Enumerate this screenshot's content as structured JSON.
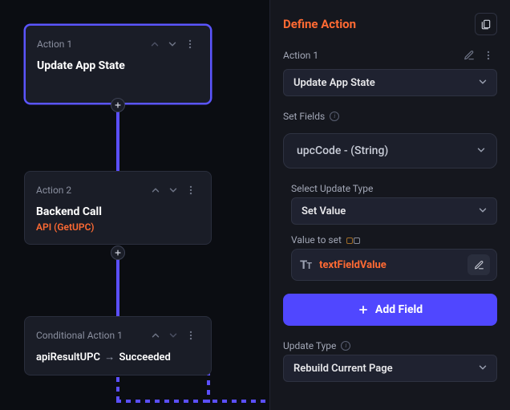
{
  "canvas": {
    "node1": {
      "label": "Action 1",
      "title": "Update App State"
    },
    "node2": {
      "label": "Action 2",
      "title": "Backend Call",
      "sub": "API (GetUPC)"
    },
    "node3": {
      "label": "Conditional Action 1",
      "cond_left": "apiResultUPC",
      "cond_arrow": "→",
      "cond_right": "Succeeded"
    }
  },
  "panel": {
    "title": "Define Action",
    "action_label": "Action 1",
    "action_select": "Update App State",
    "setfields_label": "Set Fields",
    "field_select": "upcCode - (String)",
    "update_type_label": "Select Update Type",
    "update_type_select": "Set Value",
    "value_label": "Value to set",
    "value_text": "textFieldValue",
    "add_field_btn": "Add Field",
    "update_type2_label": "Update Type",
    "update_type2_select": "Rebuild Current Page"
  }
}
